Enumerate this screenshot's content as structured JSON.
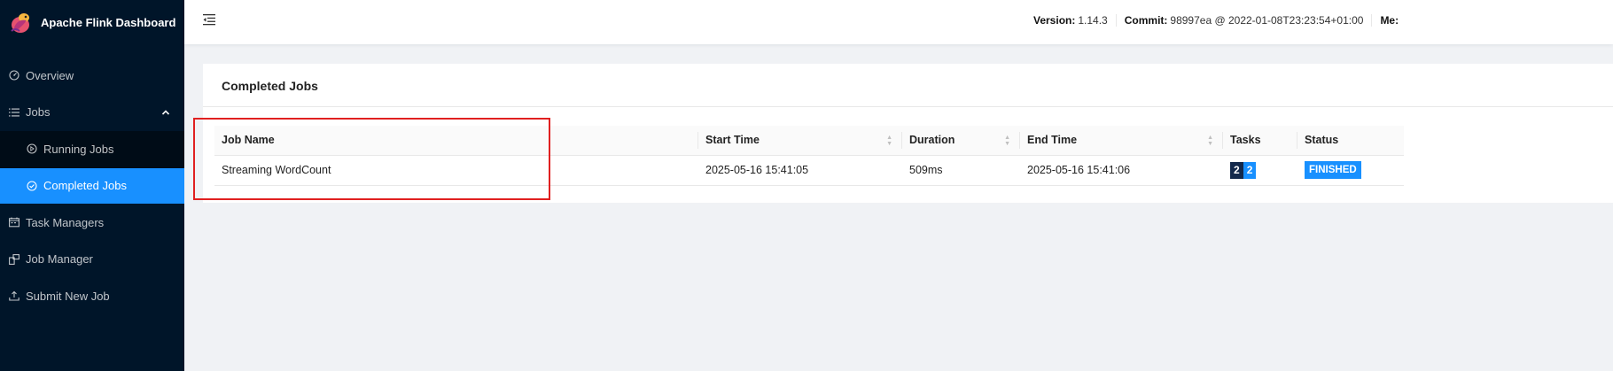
{
  "app": {
    "title": "Apache Flink Dashboard"
  },
  "sidebar": {
    "items": [
      {
        "label": "Overview",
        "icon": "dashboard-icon"
      },
      {
        "label": "Jobs",
        "icon": "list-icon",
        "expanded": true,
        "children": [
          {
            "label": "Running Jobs",
            "icon": "play-circle-icon"
          },
          {
            "label": "Completed Jobs",
            "icon": "check-circle-icon",
            "active": true
          }
        ]
      },
      {
        "label": "Task Managers",
        "icon": "schedule-icon"
      },
      {
        "label": "Job Manager",
        "icon": "build-icon"
      },
      {
        "label": "Submit New Job",
        "icon": "upload-icon"
      }
    ]
  },
  "header": {
    "version_label": "Version:",
    "version_value": "1.14.3",
    "commit_label": "Commit:",
    "commit_value": "98997ea @ 2022-01-08T23:23:54+01:00",
    "message_label": "Me:"
  },
  "card": {
    "title": "Completed Jobs",
    "columns": [
      "Job Name",
      "Start Time",
      "Duration",
      "End Time",
      "Tasks",
      "Status"
    ],
    "rows": [
      {
        "job_name": "Streaming WordCount",
        "start_time": "2025-05-16 15:41:05",
        "duration": "509ms",
        "end_time": "2025-05-16 15:41:06",
        "tasks": [
          "2",
          "2"
        ],
        "status": "FINISHED"
      }
    ]
  },
  "colors": {
    "sidebar_bg": "#001529",
    "active": "#1890ff",
    "task_total": "#13294b",
    "task_finished": "#1890ff",
    "highlight": "#e02020"
  }
}
